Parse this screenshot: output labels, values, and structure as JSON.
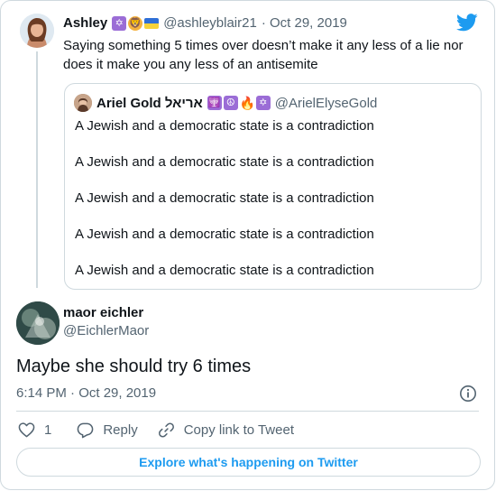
{
  "parent_tweet": {
    "name": "Ashley",
    "name_emojis": [
      "star-of-david",
      "lion",
      "ukraine-flag"
    ],
    "handle": "@ashleyblair21",
    "date": "· Oct 29, 2019",
    "text": "Saying something 5 times over doesn’t make it any less of a lie nor does it make you any less of an antisemite"
  },
  "quoted_tweet": {
    "name": "Ariel Gold אריאל",
    "name_emojis": [
      "menorah",
      "peace",
      "fire",
      "star-of-david"
    ],
    "handle": "@ArielElyseGold",
    "lines": [
      "A Jewish and a democratic state is a contradiction",
      "A Jewish and a democratic state is a contradiction",
      "A Jewish and a democratic state is a contradiction",
      "A Jewish and a democratic state is a contradiction",
      "A Jewish and a democratic state is a contradiction"
    ]
  },
  "main_tweet": {
    "name": "maor eichler",
    "handle": "@EichlerMaor",
    "text": "Maybe she should try 6 times",
    "timestamp": "6:14 PM · Oct 29, 2019"
  },
  "actions": {
    "like_count": "1",
    "reply_label": "Reply",
    "copy_link_label": "Copy link to Tweet"
  },
  "explore_label": "Explore what's happening on Twitter",
  "colors": {
    "twitter_blue": "#1d9bf0",
    "border": "#cfd9de",
    "secondary_text": "#536471"
  }
}
